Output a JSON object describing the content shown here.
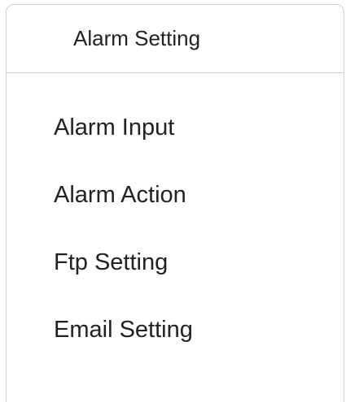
{
  "panel": {
    "title": "Alarm Setting"
  },
  "menu": {
    "items": [
      {
        "label": "Alarm Input"
      },
      {
        "label": "Alarm Action"
      },
      {
        "label": "Ftp Setting"
      },
      {
        "label": "Email Setting"
      }
    ]
  }
}
